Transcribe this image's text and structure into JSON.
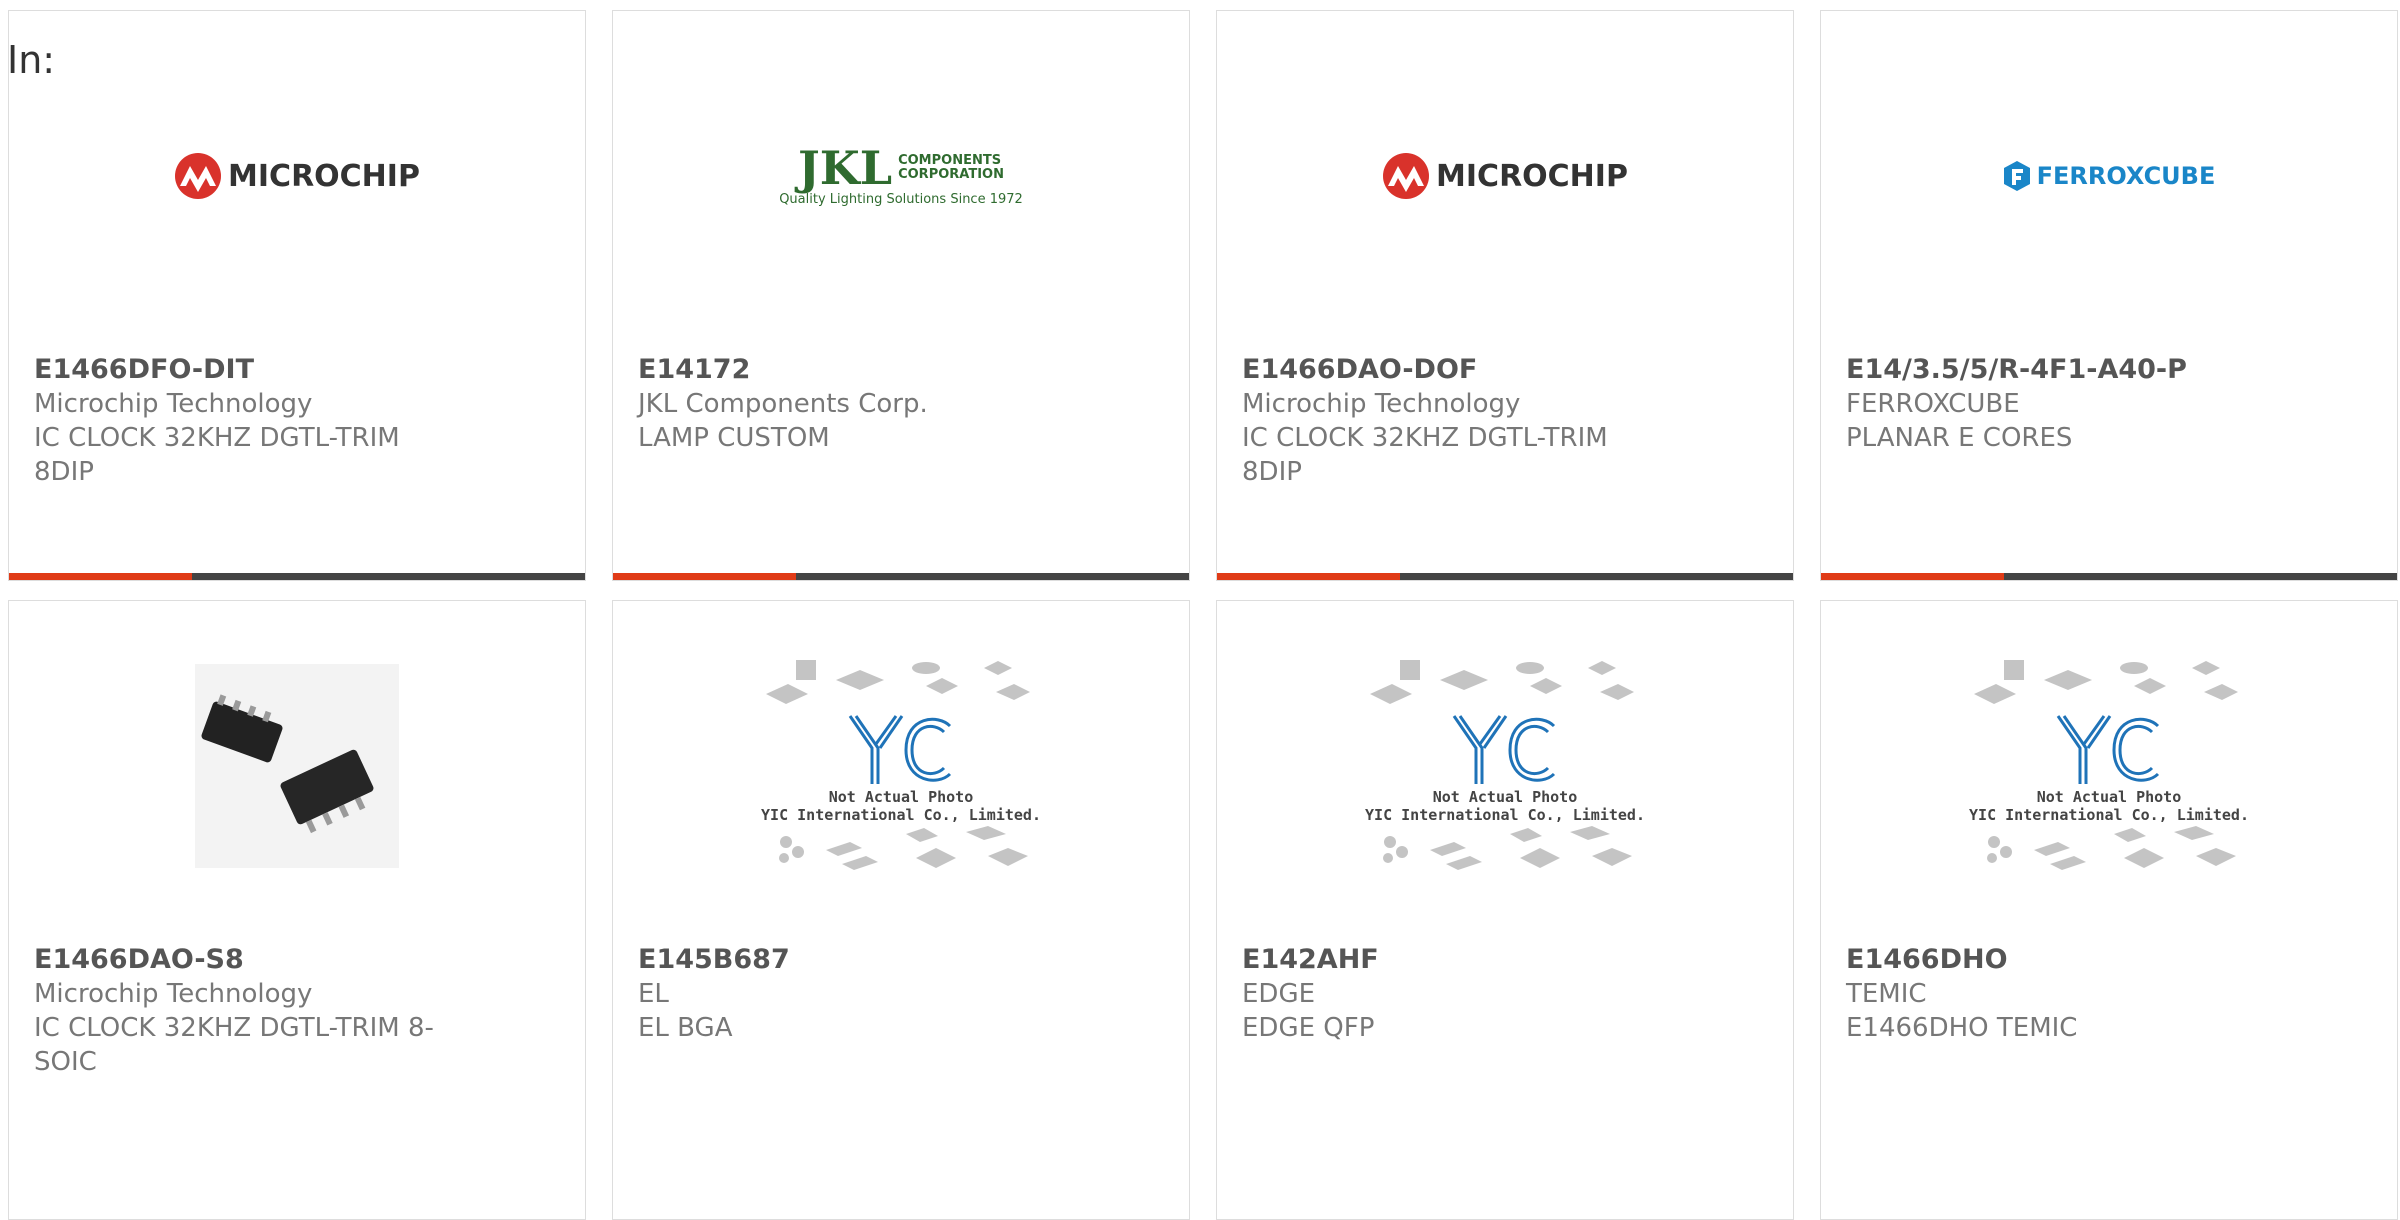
{
  "header": {
    "in_label": "In:"
  },
  "products": [
    {
      "part_number": "E1466DFO-DIT",
      "manufacturer": "Microchip Technology",
      "description": "IC CLOCK 32KHZ DGTL-TRIM 8DIP",
      "logo": "MICROCHIP"
    },
    {
      "part_number": "E14172",
      "manufacturer": "JKL Components Corp.",
      "description": "LAMP CUSTOM",
      "logo": "JKL",
      "logo_small_1": "COMPONENTS",
      "logo_small_2": "CORPORATION",
      "logo_tagline": "Quality Lighting Solutions Since 1972"
    },
    {
      "part_number": "E1466DAO-DOF",
      "manufacturer": "Microchip Technology",
      "description": "IC CLOCK 32KHZ DGTL-TRIM 8DIP",
      "logo": "MICROCHIP"
    },
    {
      "part_number": "E14/3.5/5/R-4F1-A40-P",
      "manufacturer": "FERROXCUBE",
      "description": "PLANAR E CORES",
      "logo": "FERROXCUBE"
    },
    {
      "part_number": "E1466DAO-S8",
      "manufacturer": "Microchip Technology",
      "description": "IC CLOCK 32KHZ DGTL-TRIM 8-SOIC",
      "image": "chip-photo"
    },
    {
      "part_number": "E145B687",
      "manufacturer": "EL",
      "description": "EL BGA",
      "image": "placeholder"
    },
    {
      "part_number": "E142AHF",
      "manufacturer": "EDGE",
      "description": "EDGE QFP",
      "image": "placeholder"
    },
    {
      "part_number": "E1466DHO",
      "manufacturer": "TEMIC",
      "description": "E1466DHO TEMIC",
      "image": "placeholder"
    }
  ],
  "placeholder_text": {
    "line1": "Not Actual Photo",
    "line2": "YIC International Co., Limited."
  },
  "colors": {
    "accent": "#e03b17",
    "bar": "#444444",
    "microchip_red": "#d9322b",
    "ferroxcube_blue": "#1a86c8",
    "jkl_green": "#2f6b2f",
    "yic_blue": "#1f73b8"
  }
}
